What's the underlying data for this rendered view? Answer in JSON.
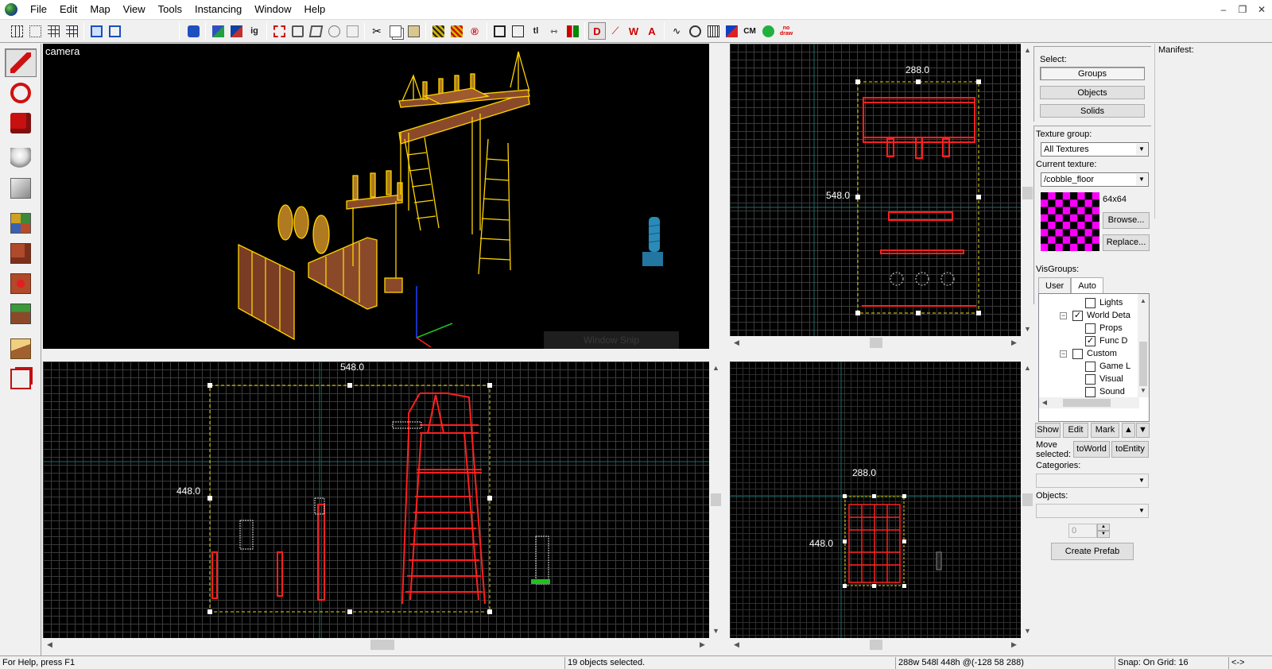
{
  "menu": {
    "items": [
      "File",
      "Edit",
      "Map",
      "View",
      "Tools",
      "Instancing",
      "Window",
      "Help"
    ],
    "window_controls": [
      "–",
      "❐",
      "✕"
    ]
  },
  "toolbar": {
    "ig_label": "ig",
    "tl_label": "tl",
    "cm_label": "CM",
    "nodraw_label_1": "no",
    "nodraw_label_2": "draw"
  },
  "viewports": {
    "camera": {
      "label": "camera",
      "snip_text": "Window Snip"
    },
    "top": {
      "width_label": "288.0",
      "height_label": "548.0"
    },
    "front": {
      "width_label": "548.0",
      "height_label": "448.0"
    },
    "side": {
      "width_label": "288.0",
      "height_label": "448.0"
    }
  },
  "panel": {
    "select_label": "Select:",
    "groups_btn": "Groups",
    "objects_btn": "Objects",
    "solids_btn": "Solids",
    "texture_group_label": "Texture group:",
    "texture_group_value": "All Textures",
    "current_texture_label": "Current texture:",
    "current_texture_value": "/cobble_floor",
    "texture_size": "64x64",
    "browse_btn": "Browse...",
    "replace_btn": "Replace...",
    "visgroups_label": "VisGroups:",
    "tab_user": "User",
    "tab_auto": "Auto",
    "tree": {
      "lights": "Lights",
      "world_detail": "World Deta",
      "props": "Props",
      "func_detail": "Func D",
      "custom": "Custom",
      "game_logic": "Game L",
      "visual": "Visual",
      "sound": "Sound"
    },
    "show_btn": "Show",
    "edit_btn": "Edit",
    "mark_btn": "Mark",
    "move_selected_label_1": "Move",
    "move_selected_label_2": "selected:",
    "to_world_btn": "toWorld",
    "to_entity_btn": "toEntity",
    "categories_label": "Categories:",
    "objects_label": "Objects:",
    "count_value": "0",
    "create_prefab_btn": "Create Prefab"
  },
  "manifest": {
    "label": "Manifest:"
  },
  "status": {
    "help": "For Help, press F1",
    "selection": "19 objects selected.",
    "dimensions": "288w 548l 448h @(-128 58 288)",
    "snap": "Snap: On Grid: 16",
    "nav": "<->"
  },
  "colors": {
    "wire_yellow": "#ffd400",
    "wood": "#8a4a2a",
    "selected_red": "#ff2020",
    "bounds_yellow": "#e8d800",
    "texture_magenta": "#ff00ff"
  }
}
